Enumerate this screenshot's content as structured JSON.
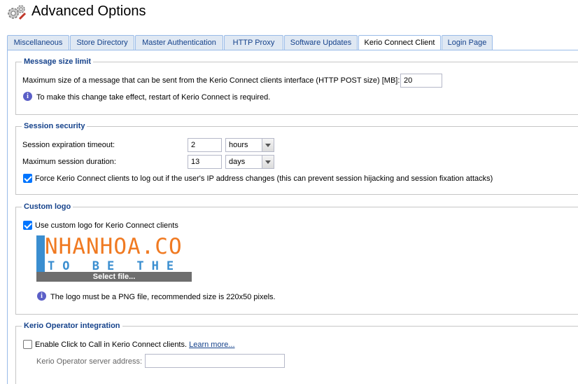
{
  "header": {
    "title": "Advanced Options",
    "icon": "gears-icon"
  },
  "tabs": [
    {
      "label": "Miscellaneous",
      "active": false
    },
    {
      "label": "Store Directory",
      "active": false
    },
    {
      "label": "Master Authentication",
      "active": false
    },
    {
      "label": "HTTP Proxy",
      "active": false
    },
    {
      "label": "Software Updates",
      "active": false
    },
    {
      "label": "Kerio Connect Client",
      "active": true
    },
    {
      "label": "Login Page",
      "active": false
    }
  ],
  "message_size": {
    "legend": "Message size limit",
    "max_label": "Maximum size of a message that can be sent from the Kerio Connect clients interface (HTTP POST size) [MB]:",
    "max_value": "20",
    "info": "To make this change take effect, restart of Kerio Connect is required."
  },
  "session": {
    "legend": "Session security",
    "timeout_label": "Session expiration timeout:",
    "timeout_value": "2",
    "timeout_unit": "hours",
    "duration_label": "Maximum session duration:",
    "duration_value": "13",
    "duration_unit": "days",
    "force_logout_label": "Force Kerio Connect clients to log out if the user's IP address changes (this can prevent session hijacking and session fixation attacks)",
    "force_logout_checked": true
  },
  "logo": {
    "legend": "Custom logo",
    "use_custom_label": "Use custom logo for Kerio Connect clients",
    "use_custom_checked": true,
    "logo_text_line1": "NHANHOA.CO",
    "logo_text_line2": "TO BE THE BE",
    "select_file_label": "Select file...",
    "info": "The logo must be a PNG file, recommended size is 220x50 pixels."
  },
  "operator": {
    "legend": "Kerio Operator integration",
    "click_to_call_label": "Enable Click to Call in Kerio Connect clients.",
    "learn_more": "Learn more...",
    "click_to_call_checked": false,
    "server_label": "Kerio Operator server address:",
    "server_value": ""
  },
  "colors": {
    "accent": "#15428b",
    "tab_border": "#99bbe8",
    "checkbox": "#0075ff",
    "info": "#5b5fc7"
  }
}
